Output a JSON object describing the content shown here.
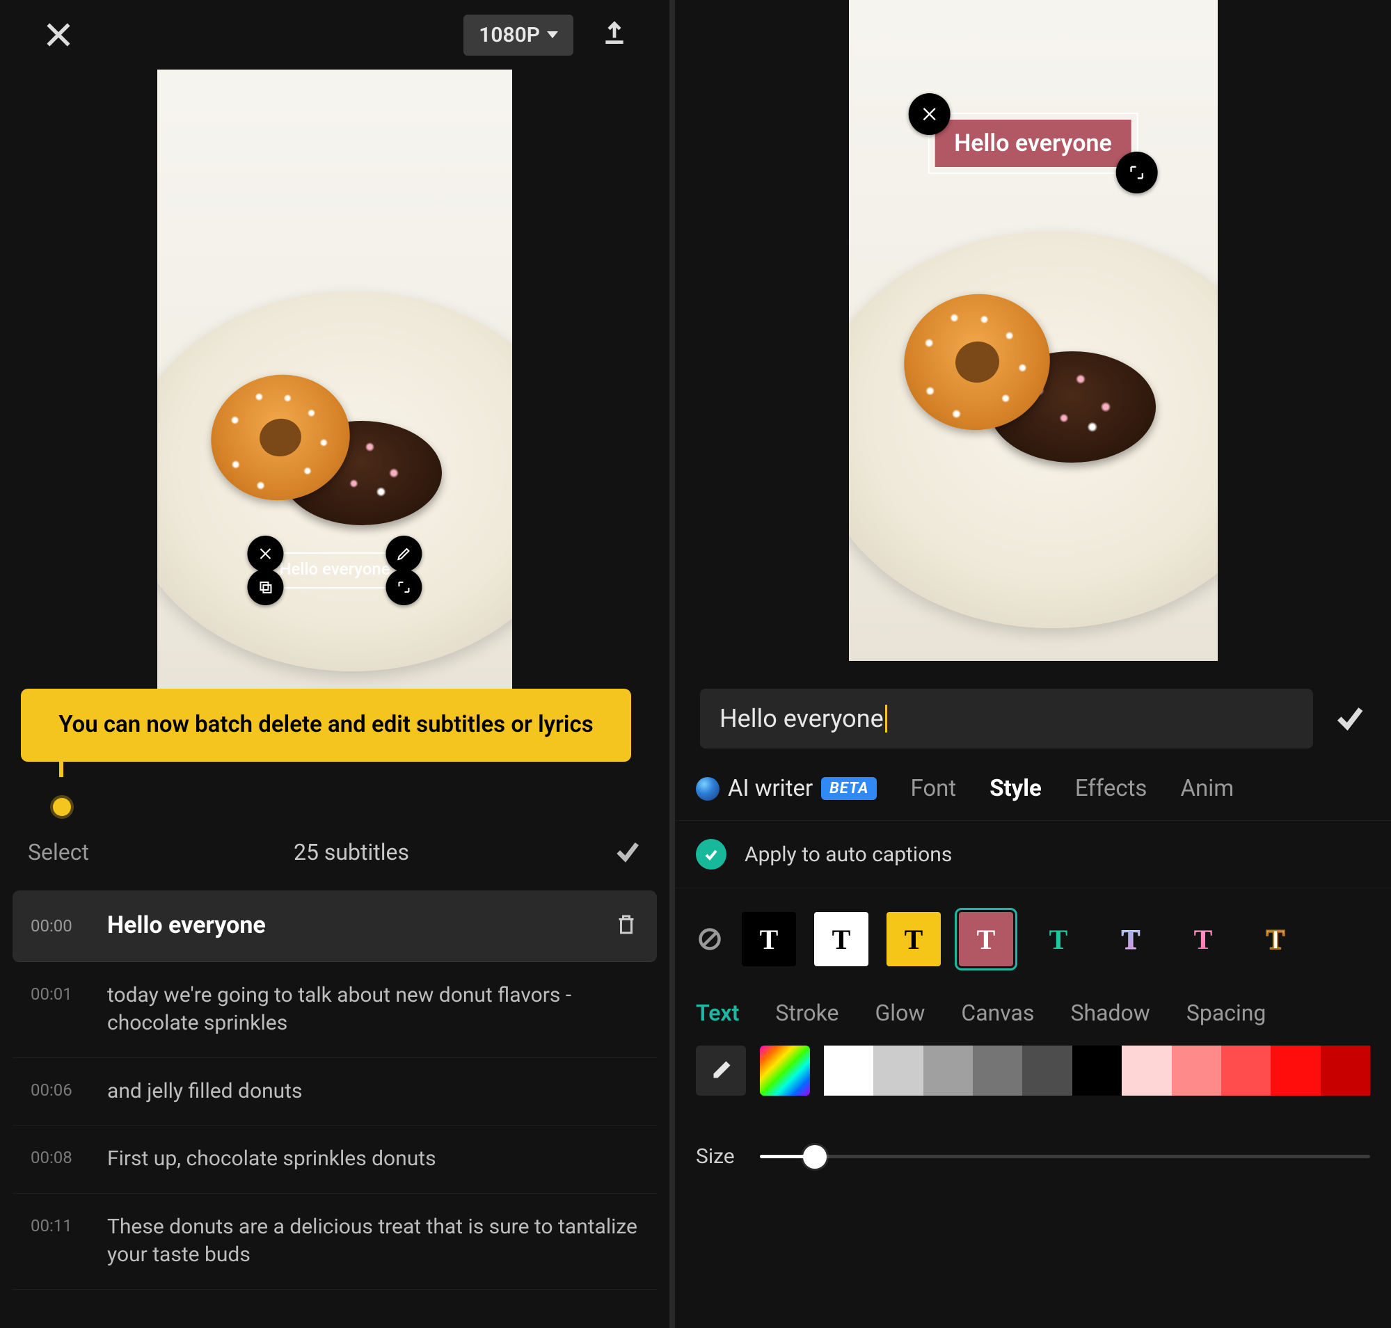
{
  "left": {
    "resolution_label": "1080P",
    "preview_caption": "Hello everyone",
    "tooltip": "You can now batch delete and edit subtitles or lyrics",
    "subtitle_header": {
      "select_label": "Select",
      "count_label": "25 subtitles"
    },
    "subtitles": [
      {
        "time": "00:00",
        "text": "Hello everyone",
        "active": true
      },
      {
        "time": "00:01",
        "text": "today we're going to talk about new donut flavors - chocolate sprinkles",
        "active": false
      },
      {
        "time": "00:06",
        "text": "and jelly filled donuts",
        "active": false
      },
      {
        "time": "00:08",
        "text": "First up, chocolate sprinkles donuts",
        "active": false
      },
      {
        "time": "00:11",
        "text": "These donuts are a delicious treat that is sure to tantalize your taste buds",
        "active": false
      }
    ]
  },
  "right": {
    "preview_caption": "Hello everyone",
    "input_value": "Hello everyone",
    "ai_writer_label": "AI writer",
    "beta_label": "BETA",
    "tabs": [
      {
        "label": "Font",
        "active": false
      },
      {
        "label": "Style",
        "active": true
      },
      {
        "label": "Effects",
        "active": false
      },
      {
        "label": "Anim",
        "active": false
      }
    ],
    "apply_label": "Apply to auto captions",
    "presets": [
      {
        "bg": "#000000",
        "fg": "#ffffff",
        "selected": false
      },
      {
        "bg": "#ffffff",
        "fg": "#000000",
        "selected": false
      },
      {
        "bg": "#f5c518",
        "fg": "#000000",
        "selected": false
      },
      {
        "bg": "#b25764",
        "fg": "#ffffff",
        "selected": true
      },
      {
        "bg": "transparent",
        "fg": "#1fc79e",
        "selected": false
      },
      {
        "bg": "transparent",
        "fg": "gradient-blue",
        "selected": false
      },
      {
        "bg": "transparent",
        "fg": "gradient-pink",
        "selected": false
      },
      {
        "bg": "transparent",
        "fg": "outline",
        "selected": false
      }
    ],
    "subtabs": [
      {
        "label": "Text",
        "active": true
      },
      {
        "label": "Stroke",
        "active": false
      },
      {
        "label": "Glow",
        "active": false
      },
      {
        "label": "Canvas",
        "active": false
      },
      {
        "label": "Shadow",
        "active": false
      },
      {
        "label": "Spacing",
        "active": false
      }
    ],
    "swatches": [
      "#ffffff",
      "#cccccc",
      "#a0a0a0",
      "#757575",
      "#4d4d4d",
      "#000000",
      "#ffd6d6",
      "#ff8a8a",
      "#ff4d4d",
      "#ff0d0d",
      "#c80000"
    ],
    "size_label": "Size",
    "size_percent": 9
  }
}
